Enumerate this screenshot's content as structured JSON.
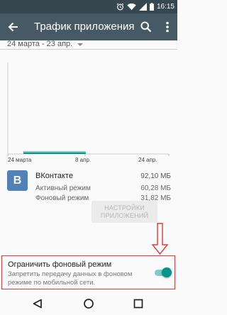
{
  "status_bar": {
    "time": "16:15",
    "icons": [
      "alarm-icon",
      "wifi-icon",
      "signal-icon",
      "battery-icon"
    ]
  },
  "toolbar": {
    "title": "Трафик приложения",
    "icons": [
      "back-arrow-icon",
      "search-icon",
      "more-vert-icon"
    ]
  },
  "date_range": {
    "label": "24 марта - 23 апр."
  },
  "chart_data": {
    "type": "area",
    "title": "",
    "xlabel": "",
    "ylabel": "",
    "x_ticks": [
      "24 марта",
      "8 апр.",
      "24 апр."
    ],
    "x_range": [
      "24 марта",
      "24 апр."
    ],
    "series": [
      {
        "values": [
          {
            "x": "27 марта",
            "y": 0.08
          },
          {
            "x": "8 апр.",
            "y": 0.12
          }
        ],
        "color": "#80cbc4"
      },
      {
        "values": [
          {
            "x": "27 марта",
            "y": 0.04
          },
          {
            "x": "8 апр.",
            "y": 0.06
          }
        ],
        "color": "#009688"
      }
    ],
    "grid": false,
    "legend": "none"
  },
  "app": {
    "name": "ВКонтакте",
    "icon_letter": "B",
    "icon_color": "#5181b8",
    "total": "92,10 МБ",
    "rows": [
      {
        "label": "Активный режим",
        "value": "60,28 МБ"
      },
      {
        "label": "Фоновый режим",
        "value": "31,82 МБ"
      }
    ]
  },
  "settings_button": {
    "label_line1": "НАСТРОЙКИ",
    "label_line2": "ПРИЛОЖЕНИЙ"
  },
  "restrict_background": {
    "title": "Ограничить фоновый режим",
    "description": "Запретить передачу данных в фоновом режиме по мобильной сети.",
    "enabled": true,
    "highlight_color": "#e53935"
  },
  "nav_bar": {
    "icons": [
      "back-triangle-icon",
      "home-circle-icon",
      "recents-square-icon"
    ]
  },
  "colors": {
    "status_bar": "#37474f",
    "toolbar": "#455a64",
    "accent": "#009688"
  }
}
